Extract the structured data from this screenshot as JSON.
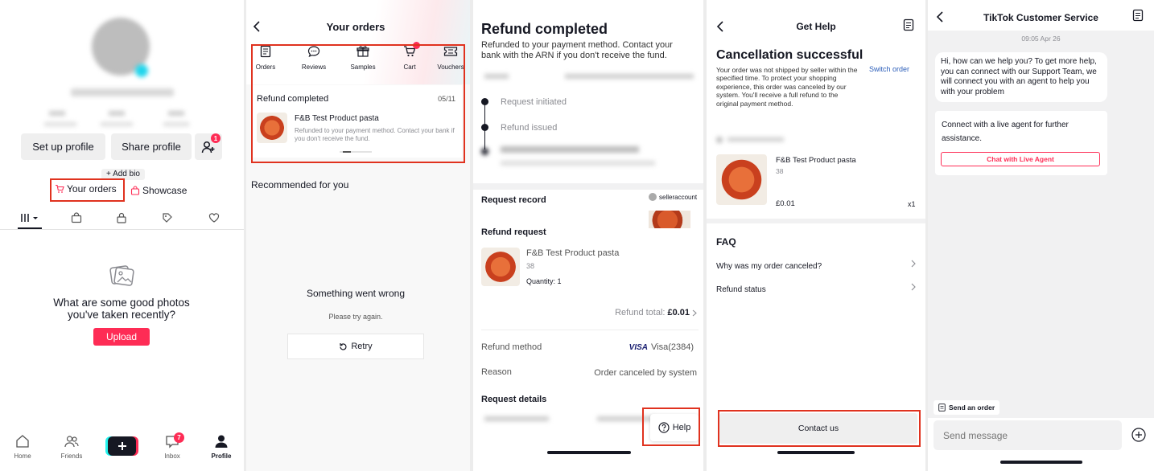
{
  "profile": {
    "setup_btn": "Set up profile",
    "share_btn": "Share profile",
    "friend_badge": "1",
    "add_bio": "+ Add bio",
    "your_orders": "Your orders",
    "showcase": "Showcase",
    "empty_title": "What are some good photos you've taken recently?",
    "upload_btn": "Upload",
    "nav": {
      "home": "Home",
      "friends": "Friends",
      "inbox": "Inbox",
      "inbox_badge": "7",
      "profile": "Profile"
    },
    "icons": [
      "grid-icon",
      "bag-icon",
      "lock-icon",
      "tag-icon",
      "heart-icon"
    ]
  },
  "orders": {
    "title": "Your orders",
    "categories": [
      "Orders",
      "Reviews",
      "Samples",
      "Cart",
      "Vouchers"
    ],
    "refund_card": {
      "status": "Refund completed",
      "date": "05/11",
      "product": "F&B Test Product pasta",
      "note": "Refunded to your payment method. Contact your bank if you don't receive the fund."
    },
    "recommended": "Recommended for you",
    "error_title": "Something went wrong",
    "error_sub": "Please try again.",
    "retry": "Retry"
  },
  "refund": {
    "title": "Refund completed",
    "subtitle": "Refunded to your payment method. Contact your bank with the ARN if you don't receive the fund.",
    "steps": [
      "Request initiated",
      "Refund issued"
    ],
    "request_record": "Request record",
    "seller": "selleraccount",
    "refund_request": "Refund request",
    "product": "F&B Test Product pasta",
    "variant": "38",
    "quantity": "Quantity: 1",
    "refund_total_label": "Refund total:",
    "refund_total": "£0.01",
    "method_label": "Refund method",
    "method_card": "VISA",
    "method_value": "Visa(2384)",
    "reason_label": "Reason",
    "reason_value": "Order canceled by system",
    "details": "Request details",
    "help": "Help"
  },
  "gethelp": {
    "title": "Get Help",
    "heading": "Cancellation successful",
    "switch": "Switch order",
    "body": "Your order was not shipped by seller within the specified time. To protect your shopping experience, this order was canceled by our system. You'll receive a full refund to the original payment method.",
    "product": "F&B Test Product pasta",
    "variant": "38",
    "price": "£0.01",
    "qty": "x1",
    "faq_title": "FAQ",
    "faq": [
      "Why was my order canceled?",
      "Refund status"
    ],
    "contact": "Contact us"
  },
  "chat": {
    "title": "TikTok Customer Service",
    "time": "09:05 Apr 26",
    "msg1": "Hi, how can we help you? To get more help, you can connect with our Support Team, we will connect you with an agent to help you with your problem",
    "msg2": "Connect with a live agent for further assistance.",
    "live_agent": "Chat with Live Agent",
    "send_order": "Send an order",
    "placeholder": "Send message"
  },
  "colors": {
    "accent": "#fe2c55",
    "highlight": "#e0321f"
  }
}
